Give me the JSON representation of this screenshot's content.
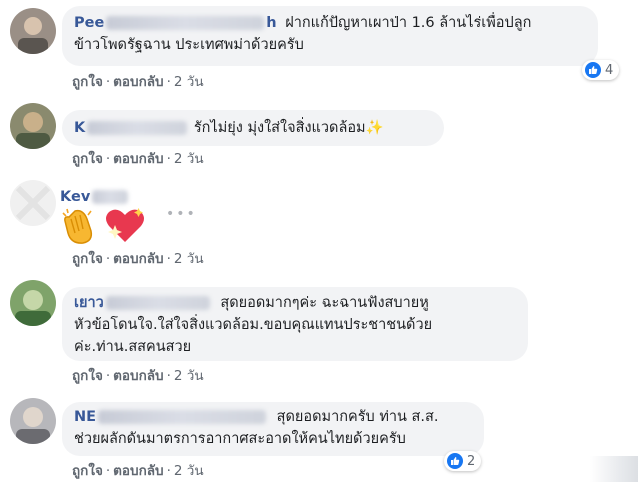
{
  "actions": {
    "like": "ถูกใจ",
    "reply": "ตอบกลับ",
    "time": "2 วัน",
    "separator": "·"
  },
  "comments": [
    {
      "author_visible": "Pee",
      "author_tail": "h",
      "text_line1": "ฝากแก้ปัญหาเผาป่า 1.6 ล้านไร่เพื่อปลูก",
      "text_line2": "ข้าวโพดรัฐฉาน ประเทศพม่าด้วยครับ",
      "reaction_count": "4"
    },
    {
      "author_visible": "K",
      "text": "รักไม่ยุ่ง มุ่งใส่ใจสิ่งแวดล้อม",
      "trailing_emoji": "✨"
    },
    {
      "author_visible": "Kev",
      "emojis": [
        "clapping-hands",
        "sparkling-heart"
      ]
    },
    {
      "author_visible": "เยาว",
      "text_line1": "สุดยอดมากๆค่ะ ฉะฉานฟังสบายหู",
      "text_line2": "หัวข้อโดนใจ.ใส่ใจสิ่งแวดล้อม.ขอบคุณแทนประชาชนด้วย",
      "text_line3": "ค่ะ.ท่าน.สสคนสวย"
    },
    {
      "author_visible": "NE",
      "text_line1": "สุดยอดมากครับ ท่าน ส.ส.",
      "text_line2": "ช่วยผลักดันมาตรการอากาศสะอาดให้คนไทยด้วยครับ",
      "reaction_count": "2"
    }
  ],
  "colors": {
    "author": "#385898",
    "bubble": "#f2f3f5",
    "like": "#1877f2",
    "meta": "#606770"
  },
  "icons": [
    "like-icon",
    "more-options-icon"
  ]
}
